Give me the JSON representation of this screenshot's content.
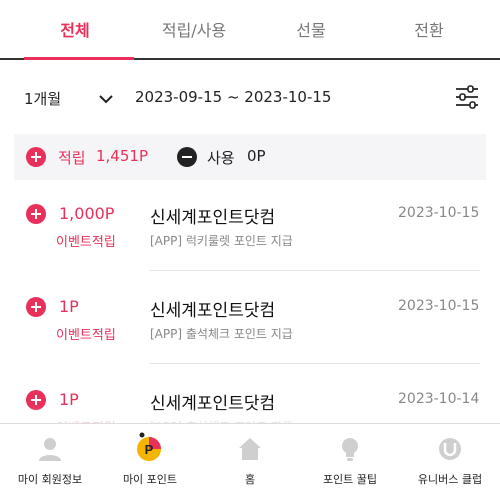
{
  "tabs": {
    "all": "전체",
    "earn_use": "적립/사용",
    "gift": "선물",
    "convert": "전환"
  },
  "filter": {
    "period": "1개월",
    "range": "2023-09-15 ~ 2023-10-15"
  },
  "summary": {
    "earn_label": "적립",
    "earn_value": "1,451P",
    "use_label": "사용",
    "use_value": "0P"
  },
  "transactions": [
    {
      "amount": "1,000P",
      "type": "이벤트적립",
      "store": "신세계포인트닷컴",
      "date": "2023-10-15",
      "desc": "[APP] 럭키룰렛 포인트 지급"
    },
    {
      "amount": "1P",
      "type": "이벤트적립",
      "store": "신세계포인트닷컴",
      "date": "2023-10-15",
      "desc": "[APP] 출석체크 포인트 지급"
    },
    {
      "amount": "1P",
      "type": "이벤트적립",
      "store": "신세계포인트닷컴",
      "date": "2023-10-14",
      "desc": "[APP] 출석체크 포인트 지급"
    }
  ],
  "nav": {
    "member": "마이 회원정보",
    "point": "마이 포인트",
    "home": "홈",
    "tips": "포인트 꿀팁",
    "universe": "유니버스 클럽"
  },
  "colors": {
    "accent": "#e8305a",
    "muted": "#888888",
    "nav_icon": "#cfcfcf"
  },
  "icons": {
    "period_toggle": "chevron-down-icon",
    "filter": "filter-sliders-icon",
    "earn": "plus-circle-icon",
    "use": "minus-circle-icon"
  }
}
